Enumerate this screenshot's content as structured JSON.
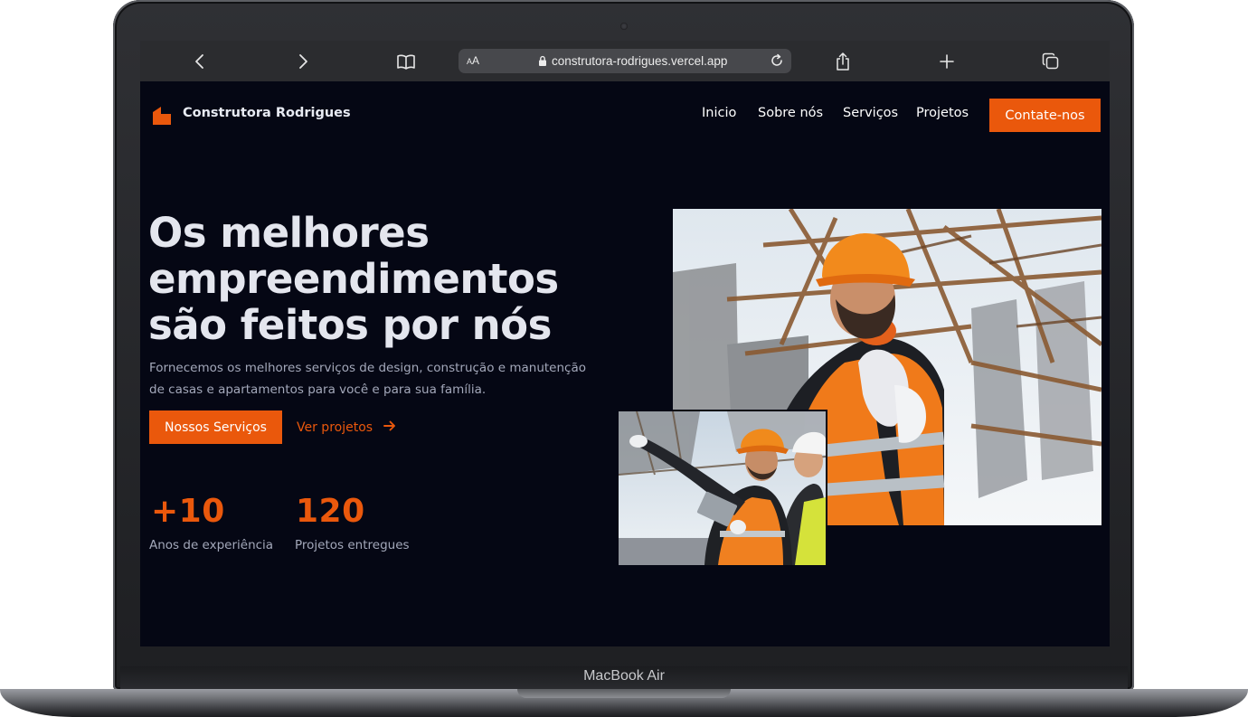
{
  "device": {
    "label": "MacBook Air"
  },
  "browser": {
    "aa_label_small": "A",
    "aa_label_large": "A",
    "url": "construtora-rodrigues.vercel.app",
    "icons": [
      "back-icon",
      "forward-icon",
      "book-icon",
      "lock-icon",
      "reload-icon",
      "share-icon",
      "plus-icon",
      "tabs-icon"
    ]
  },
  "site": {
    "brand": "Construtora Rodrigues",
    "nav": [
      "Inicio",
      "Sobre nós",
      "Serviços",
      "Projetos"
    ],
    "cta": "Contate-nos"
  },
  "hero": {
    "title_lines": [
      "Os melhores",
      "empreendimentos",
      "são feitos por nós"
    ],
    "subtitle_lines": [
      "Fornecemos os melhores serviços de design, construção e manutenção",
      "de casas e apartamentos para você e para sua família."
    ],
    "primary_button": "Nossos Serviços",
    "secondary_link": "Ver projetos"
  },
  "stats": [
    {
      "value": "+10",
      "label": "Anos de experiência"
    },
    {
      "value": "120",
      "label": "Projetos entregues"
    }
  ],
  "colors": {
    "accent": "#ea580c",
    "background": "#050714",
    "heading": "#e4e6ee",
    "muted": "#a3a8ba"
  }
}
